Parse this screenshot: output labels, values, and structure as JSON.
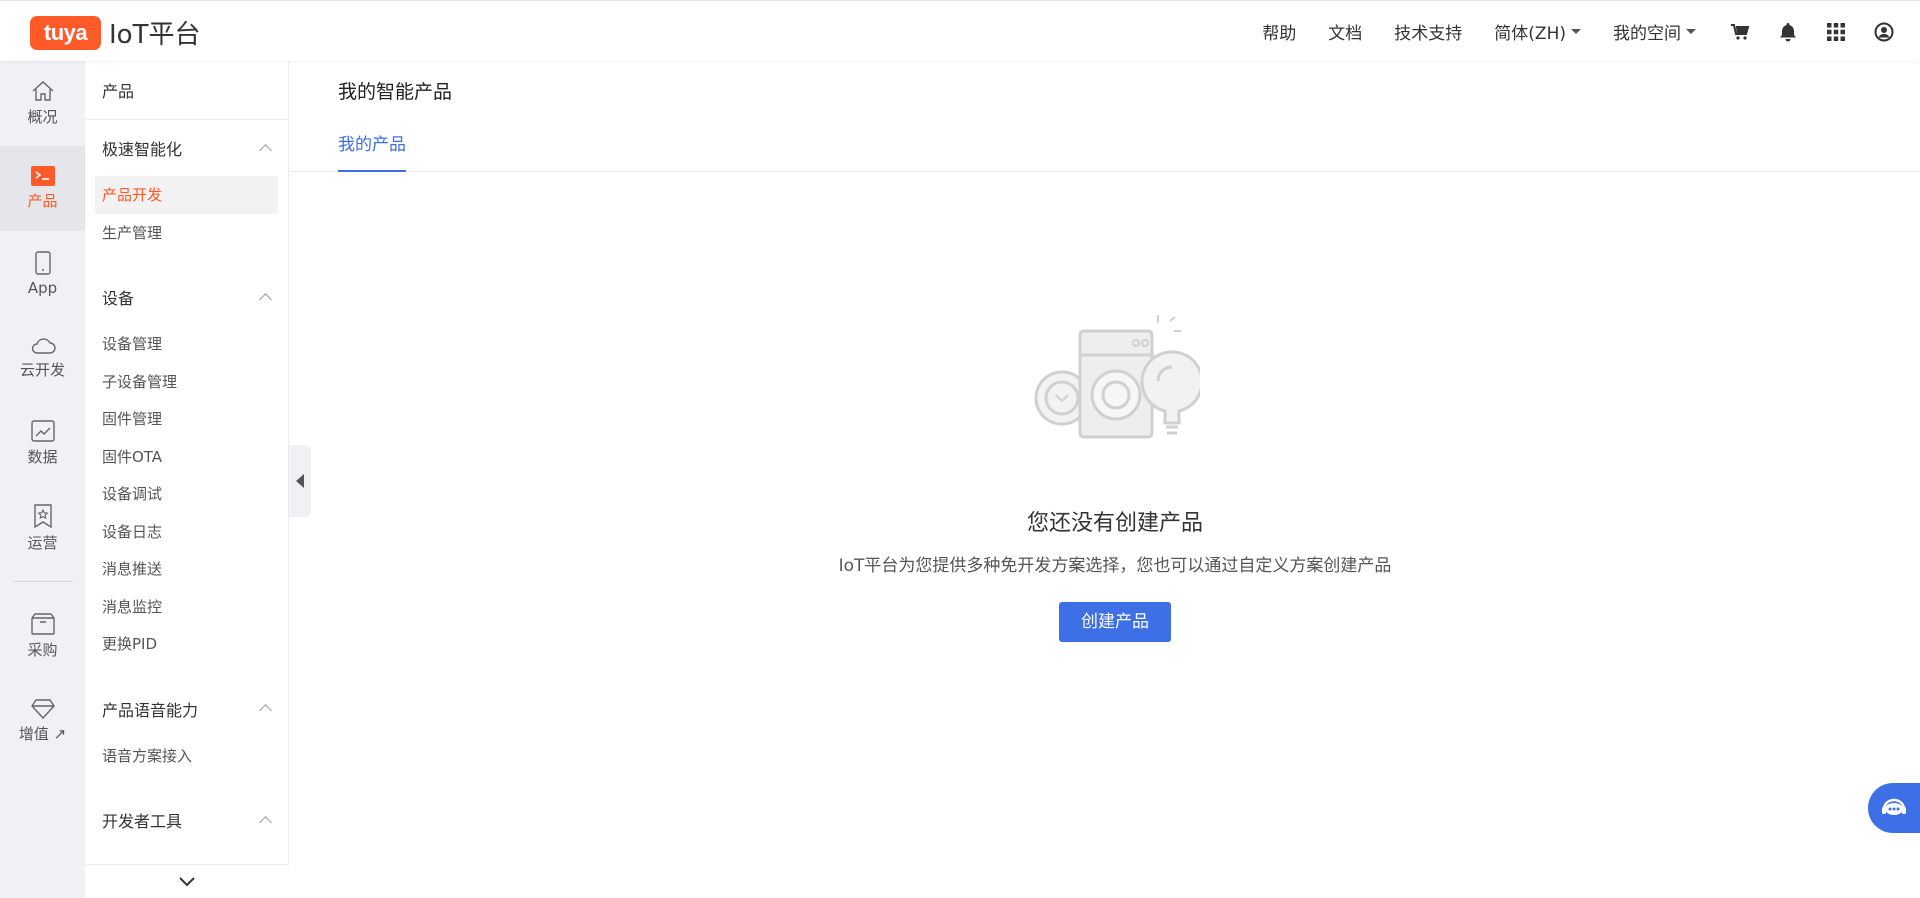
{
  "header": {
    "logo_badge": "tuya",
    "logo_text": "IoT平台",
    "nav": [
      "帮助",
      "文档",
      "技术支持"
    ],
    "language": "简体(ZH)",
    "space": "我的空间"
  },
  "rail": {
    "items": [
      {
        "label": "概况",
        "icon": "home-icon"
      },
      {
        "label": "产品",
        "icon": "terminal-icon"
      },
      {
        "label": "App",
        "icon": "phone-icon"
      },
      {
        "label": "云开发",
        "icon": "cloud-icon"
      },
      {
        "label": "数据",
        "icon": "chart-icon"
      },
      {
        "label": "运营",
        "icon": "bookmark-star-icon"
      },
      {
        "label": "采购",
        "icon": "box-icon"
      },
      {
        "label": "增值",
        "icon": "diamond-icon"
      }
    ]
  },
  "sidebar": {
    "header": "产品",
    "groups": [
      {
        "label": "极速智能化",
        "items": [
          "产品开发",
          "生产管理"
        ]
      },
      {
        "label": "设备",
        "items": [
          "设备管理",
          "子设备管理",
          "固件管理",
          "固件OTA",
          "设备调试",
          "设备日志",
          "消息推送",
          "消息监控",
          "更换PID"
        ]
      },
      {
        "label": "产品语音能力",
        "items": [
          "语音方案接入"
        ]
      },
      {
        "label": "开发者工具",
        "items": []
      }
    ]
  },
  "main": {
    "title": "我的智能产品",
    "tab": "我的产品",
    "empty_title": "您还没有创建产品",
    "empty_desc": "IoT平台为您提供多种免开发方案选择，您也可以通过自定义方案创建产品",
    "create_button": "创建产品"
  },
  "colors": {
    "brand": "#ff5a28",
    "accent": "#3d6fe6"
  }
}
